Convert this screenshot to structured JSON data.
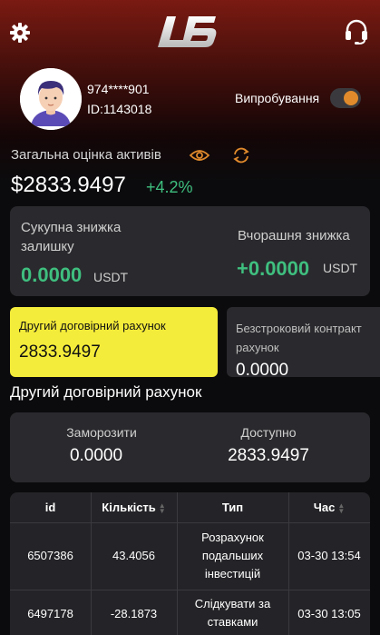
{
  "header": {
    "settings_icon": "gear-icon",
    "logo_text": "LB",
    "support_icon": "headset-icon"
  },
  "profile": {
    "username": "974****901",
    "user_id": "ID:1143018",
    "trial_label": "Випробування",
    "trial_enabled": true
  },
  "assets": {
    "title": "Загальна оцінка активів",
    "total": "$2833.9497",
    "change": "+4.2%"
  },
  "loss": {
    "total_label": "Сукупна знижка залишку",
    "total_value": "0.0000",
    "total_unit": "USDT",
    "yesterday_label": "Вчорашня знижка",
    "yesterday_value": "+0.0000",
    "yesterday_unit": "USDT"
  },
  "accounts": [
    {
      "label": "Другий договірний рахунок",
      "value": "2833.9497",
      "active": true
    },
    {
      "label": "Безстроковий контракт рахунок",
      "label_line1": "Безстроковий контракт",
      "label_line2": "рахунок",
      "value": "0.0000",
      "active": false
    }
  ],
  "section_title": "Другий договірний рахунок",
  "balance": {
    "freeze_label": "Заморозити",
    "freeze_value": "0.0000",
    "available_label": "Доступно",
    "available_value": "2833.9497"
  },
  "table": {
    "headers": [
      "id",
      "Кількість",
      "Тип",
      "Час"
    ],
    "rows": [
      {
        "id": "6507386",
        "amount": "43.4056",
        "type": "Розрахунок подальших інвестицій",
        "type_lines": [
          "Розрахунок",
          "подальших",
          "інвестицій"
        ],
        "time": "03-30 13:54"
      },
      {
        "id": "6497178",
        "amount": "-28.1873",
        "type": "Слідкувати за ставками",
        "type_lines": [
          "Слідкувати за",
          "ставками"
        ],
        "time": "03-30 13:05"
      }
    ]
  },
  "colors": {
    "accent_yellow": "#f4ec3a",
    "positive_green": "#3fbf7f",
    "toggle_orange": "#e08a2c",
    "card_bg": "#2a2a2e"
  }
}
